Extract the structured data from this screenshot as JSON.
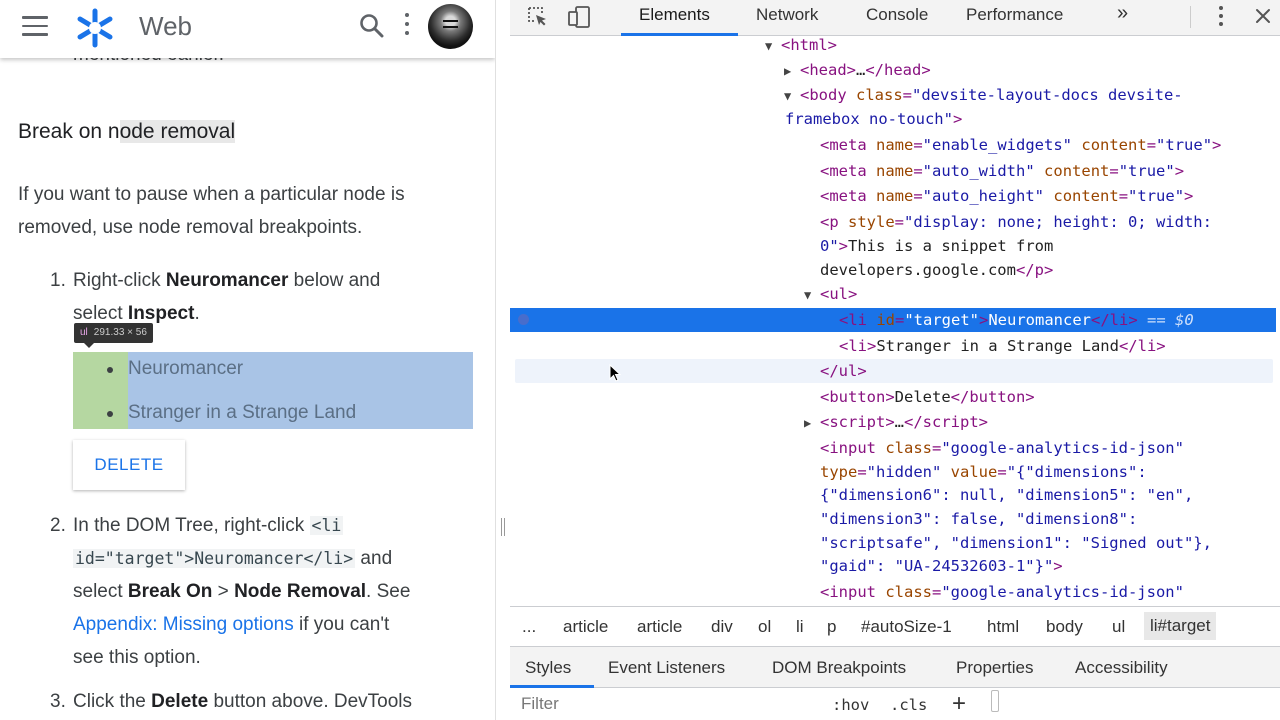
{
  "site": {
    "brand": "Web",
    "cut_text": "mentioned earlier."
  },
  "article": {
    "heading_pre": "Break on n",
    "heading_hl": "ode removal",
    "para_l1": "If you want to pause when a particular node is",
    "para_l2": "removed, use node removal breakpoints.",
    "step1": {
      "num": "1.",
      "pre": "Right-click ",
      "b1": "Neuromancer",
      "mid": " below and",
      "l2_pre": "select ",
      "b2": "Inspect",
      "end": "."
    },
    "tooltip": {
      "tag": "ul",
      "dims": "291.33 × 56"
    },
    "list_items": [
      "Neuromancer",
      "Stranger in a Strange Land"
    ],
    "delete_label": "DELETE",
    "step2": {
      "num": "2.",
      "pre": "In the DOM Tree, right-click ",
      "code1": "<li",
      "code2": "id=\"target\">Neuromancer</li>",
      "and": " and",
      "select": "select ",
      "b1": "Break On",
      "gt": " > ",
      "b2": "Node Removal",
      "see": ". See",
      "link": "Appendix: Missing options",
      "after_link": " if you can't",
      "l4": "see this option."
    },
    "step3": {
      "num": "3.",
      "pre": "Click the ",
      "b": "Delete",
      "post": " button above. DevTools"
    }
  },
  "devtools": {
    "tabs": [
      "Elements",
      "Network",
      "Console",
      "Performance"
    ],
    "more": "»",
    "dom": {
      "html": "<html>",
      "head_open": "<head>",
      "head_ellipsis": "…",
      "head_close": "</head>",
      "body_open": "<body ",
      "body_attr": "class",
      "body_val": "\"devsite-layout-docs devsite-",
      "body_val2": "framebox no-touch\"",
      "meta1": [
        "enable_widgets",
        "true"
      ],
      "meta2": [
        "auto_width",
        "true"
      ],
      "meta3": [
        "auto_height",
        "true"
      ],
      "p_style": "\"display: none; height: 0; width:",
      "p_style2": "0\"",
      "p_text": "This is a snippet from",
      "p_text2": "developers.google.com",
      "ul_open": "<ul>",
      "li1_text": "Neuromancer",
      "li1_id": "\"target\"",
      "selected_marker": "== $0",
      "li2_text": "Stranger in a Strange Land",
      "ul_close": "</ul>",
      "button_text": "Delete",
      "script_ellipsis": "…",
      "input_class": "\"google-analytics-id-json\"",
      "input_type": "\"hidden\"",
      "input_value_l1": "\"{\"dimensions\":",
      "input_value_l2": "{\"dimension6\": null, \"dimension5\": \"en\",",
      "input_value_l3": "\"dimension3\": false, \"dimension8\":",
      "input_value_l4": "\"scriptsafe\", \"dimension1\": \"Signed out\"},",
      "input_value_l5": "\"gaid\": \"UA-24532603-1\"}\"",
      "input2_class": "\"google-analytics-id-json\""
    },
    "breadcrumbs": [
      "...",
      "article",
      "article",
      "div",
      "ol",
      "li",
      "p",
      "#autoSize-1",
      "html",
      "body",
      "ul",
      "li#target"
    ],
    "subtabs": [
      "Styles",
      "Event Listeners",
      "DOM Breakpoints",
      "Properties",
      "Accessibility"
    ],
    "filter_placeholder": "Filter",
    "hov": ":hov",
    "cls": ".cls",
    "plus": "+"
  },
  "colors": {
    "accent": "#1a73e8",
    "tag": "#881280",
    "attr_name": "#994500",
    "attr_value": "#1a1aa6"
  }
}
